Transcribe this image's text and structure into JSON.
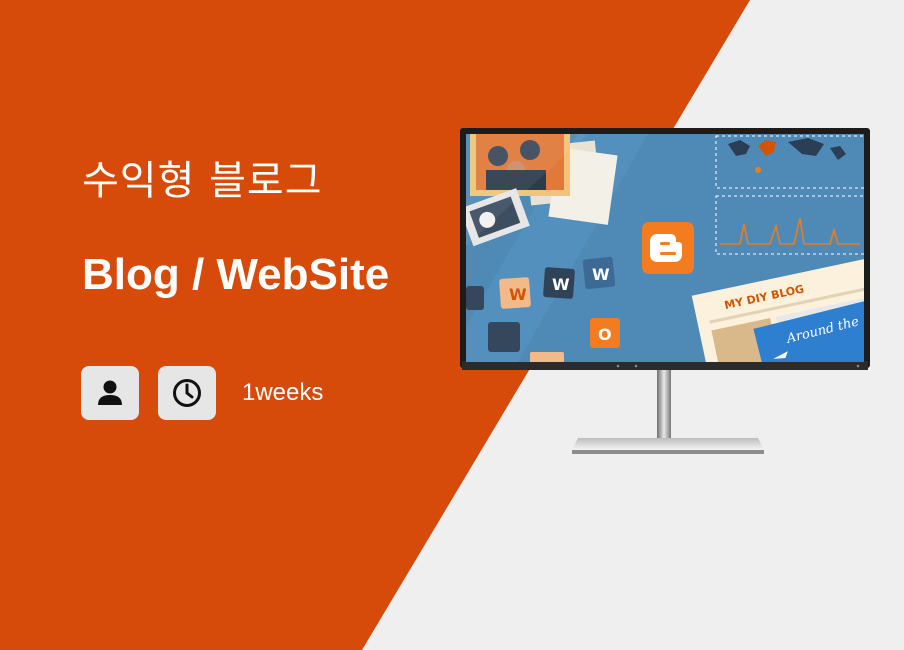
{
  "colors": {
    "accent": "#d64a0a",
    "background": "#efefef",
    "screen_blue": "#4f8ab7",
    "blogger_orange": "#f37c21"
  },
  "hero": {
    "title_korean": "수익형 블로그",
    "title_english": "Blog / WebSite"
  },
  "meta": {
    "author_icon": "person-icon",
    "duration_icon": "clock-icon",
    "duration_text": "1weeks"
  },
  "screen": {
    "blog_title": "MY DIY BLOG",
    "travel_text": "Around the",
    "tiles": [
      "W",
      "W",
      "W",
      "O"
    ]
  }
}
